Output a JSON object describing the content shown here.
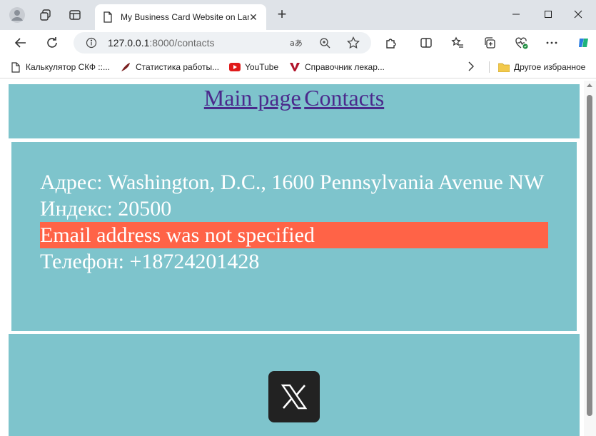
{
  "browser": {
    "tab_title": "My Business Card Website on Lara",
    "url_host": "127.0.0.1",
    "url_rest": ":8000/contacts",
    "bookmarks": [
      {
        "label": "Калькулятор СКФ ::..."
      },
      {
        "label": "Статистика работы..."
      },
      {
        "label": "YouTube"
      },
      {
        "label": "Справочник лекар..."
      }
    ],
    "other_favorites": "Другое избранное"
  },
  "page": {
    "nav": {
      "main_page": "Main page",
      "contacts": "Contacts"
    },
    "contact": {
      "address": "Адрес: Washington, D.C., 1600 Pennsylvania Avenue NW",
      "index": "Индекс: 20500",
      "email_missing": "Email address was not specified",
      "phone": "Телефон: +18724201428"
    },
    "colors": {
      "block_bg": "#7ec4cc",
      "email_highlight": "#ff6347",
      "link": "#4b2a8c"
    }
  }
}
